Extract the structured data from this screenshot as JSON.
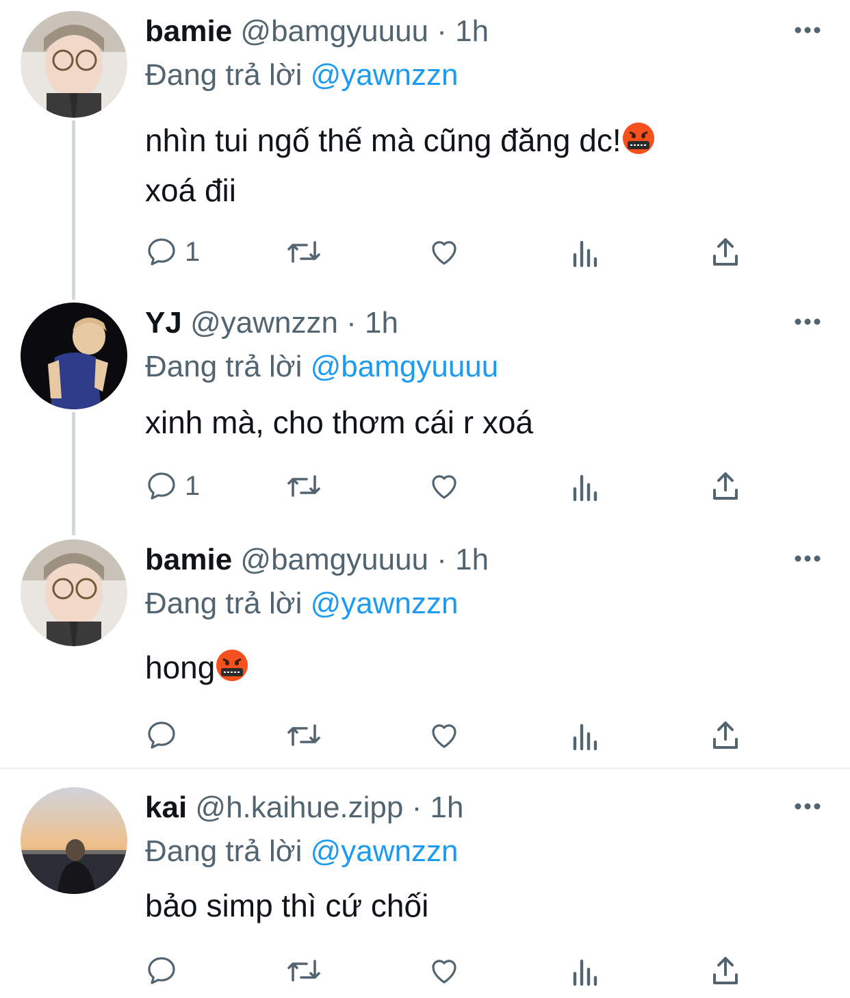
{
  "colors": {
    "accent": "#1d9bf0",
    "secondary_text": "#536471",
    "thread_line": "#cfd9de",
    "emoji_face": "#f4511e"
  },
  "labels": {
    "reply_prefix": "Đang trả lời",
    "separator": "·"
  },
  "tweets": [
    {
      "name": "bamie",
      "handle": "@bamgyuuuu",
      "time": "1h",
      "reply_to": "@yawnzzn",
      "text_lines": [
        "nhìn tui ngố thế mà cũng đăng dc!",
        "xoá đii"
      ],
      "reply_count": "1",
      "avatar_icon": "bamie-avatar"
    },
    {
      "name": "YJ",
      "handle": "@yawnzzn",
      "time": "1h",
      "reply_to": "@bamgyuuuu",
      "text_lines": [
        "xinh mà, cho thơm cái r xoá"
      ],
      "reply_count": "1",
      "avatar_icon": "yj-avatar"
    },
    {
      "name": "bamie",
      "handle": "@bamgyuuuu",
      "time": "1h",
      "reply_to": "@yawnzzn",
      "text_lines": [
        "hong"
      ],
      "reply_count": "",
      "avatar_icon": "bamie-avatar"
    },
    {
      "name": "kai",
      "handle": "@h.kaihue.zipp",
      "time": "1h",
      "reply_to": "@yawnzzn",
      "text_lines": [
        "bảo simp thì cứ chối"
      ],
      "reply_count": "",
      "avatar_icon": "kai-avatar"
    }
  ],
  "icons": [
    "reply-icon",
    "retweet-icon",
    "like-icon",
    "views-icon",
    "share-icon",
    "more-options-icon",
    "symbols-over-mouth-emoji"
  ]
}
